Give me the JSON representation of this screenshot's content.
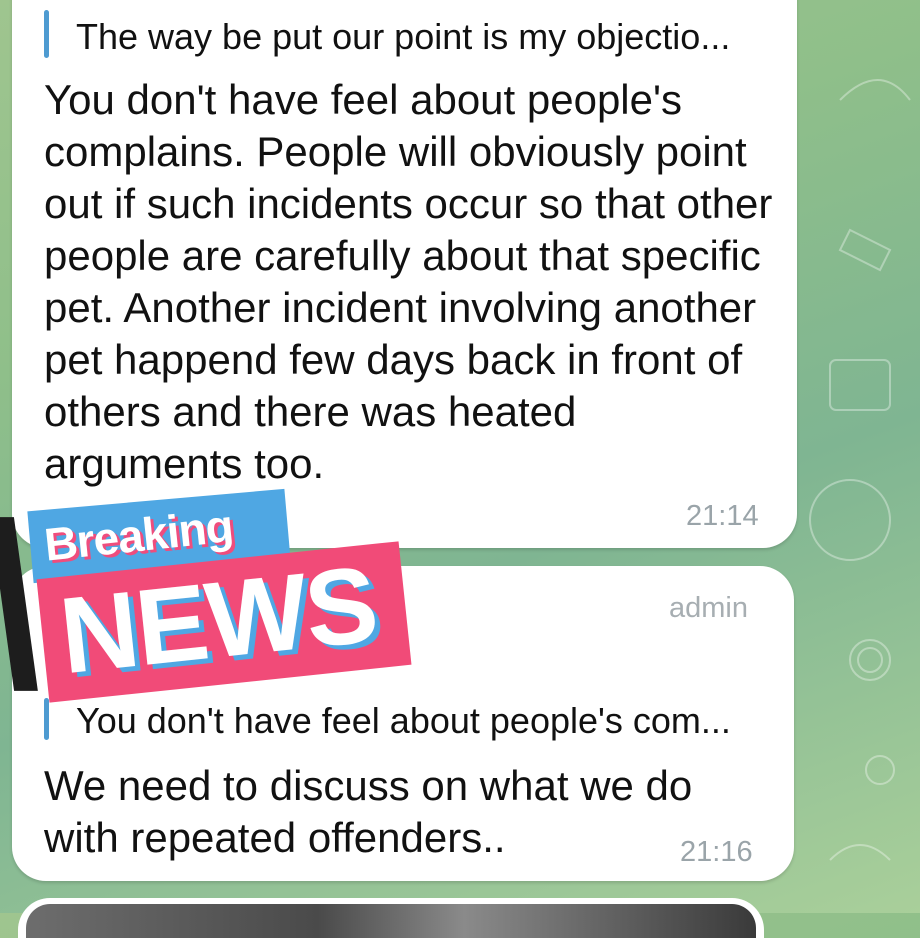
{
  "messages": [
    {
      "reply_snippet": "The way be put our point is my objectio...",
      "text": "You don't have feel about people's complains. People will obviously point out if such incidents occur so that other people are carefully about that specific pet. Another incident involving another pet happend few days back in front of others and there was heated arguments too.",
      "time": "21:14"
    },
    {
      "author_role": "admin",
      "reply_snippet": "You don't have feel about people's com...",
      "text": "We need to discuss on what we do with repeated offenders..",
      "time": "21:16"
    }
  ],
  "sticker": {
    "line1": "Breaking",
    "line2": "NEWS"
  },
  "colors": {
    "reply_accent": "#4e9bd1",
    "sticker_blue": "#4fa7e3",
    "sticker_pink": "#f14b78",
    "chat_background": "#8fbf8a"
  }
}
